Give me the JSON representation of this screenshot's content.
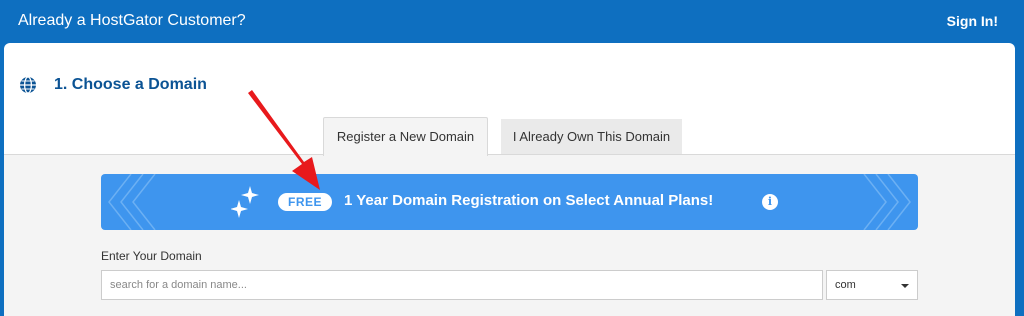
{
  "header": {
    "title": "Already a HostGator Customer?",
    "signin_label": "Sign In!"
  },
  "section": {
    "title": "1. Choose a Domain",
    "icon": "globe-icon"
  },
  "tabs": [
    {
      "label": "Register a New Domain",
      "active": true
    },
    {
      "label": "I Already Own This Domain",
      "active": false
    }
  ],
  "promo": {
    "badge": "FREE",
    "text": "1 Year Domain Registration on Select Annual Plans!",
    "info_icon": "info-icon",
    "color": "#3e95ee"
  },
  "domain_search": {
    "label": "Enter Your Domain",
    "placeholder": "search for a domain name...",
    "value": "",
    "tld": "com"
  },
  "colors": {
    "brand": "#0e6fc0",
    "heading": "#0b5394",
    "annotation_arrow": "#e8191c"
  }
}
